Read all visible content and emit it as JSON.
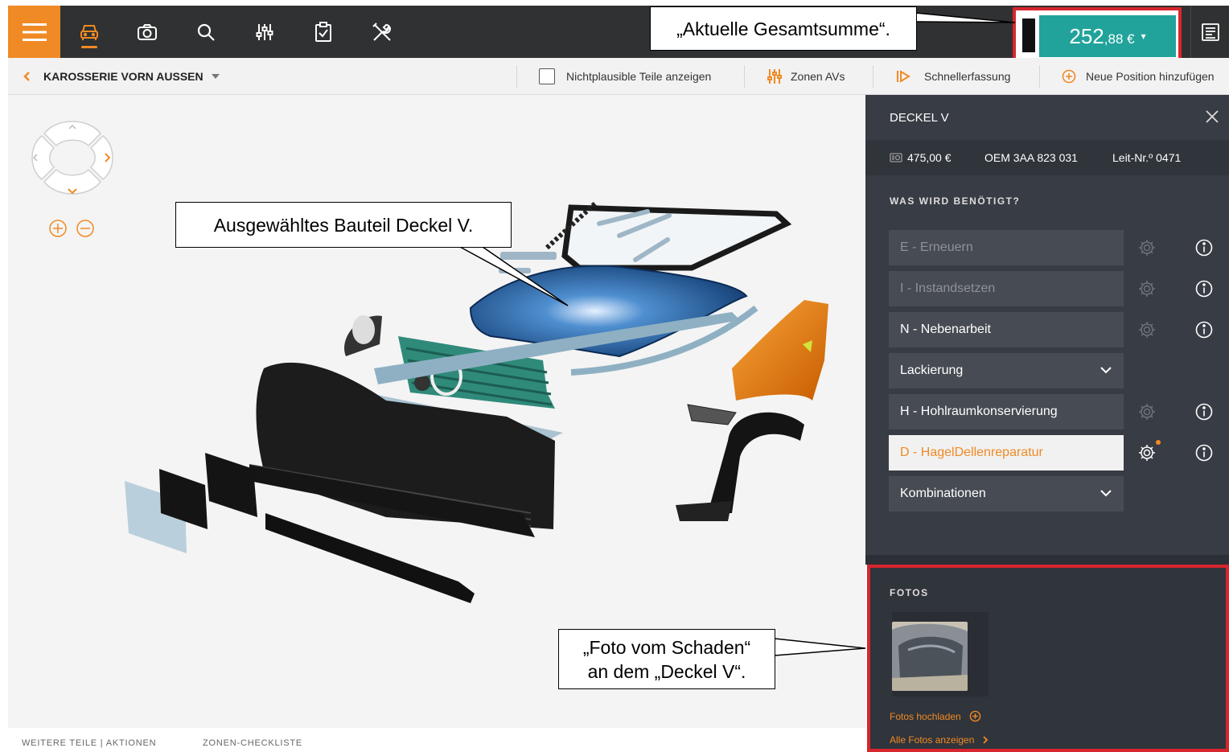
{
  "topbar": {
    "icons": [
      "menu-icon",
      "car-icon",
      "camera-icon",
      "search-icon",
      "sliders-icon",
      "clipboard-check-icon",
      "tools-icon",
      "receipt-icon"
    ],
    "total": {
      "main": "252",
      "cents": ",88 €",
      "caret": "▾"
    },
    "accent": "#f08a24",
    "total_color": "#21a39b",
    "highlight_color": "#d7262e"
  },
  "subbar": {
    "breadcrumb": "KAROSSERIE VORN AUSSEN",
    "implausible_label": "Nichtplausible Teile anzeigen",
    "zones_label": "Zonen AVs",
    "quick_label": "Schnellerfassung",
    "new_position_label": "Neue Position hinzufügen"
  },
  "canvas": {
    "bottom_links": [
      "WEITERE TEILE | AKTIONEN",
      "ZONEN-CHECKLISTE"
    ]
  },
  "panel": {
    "title": "DECKEL V",
    "price": "475,00 €",
    "oem": "OEM 3AA 823 031",
    "leit": "Leit-Nr.º 0471",
    "section_heading": "WAS WIRD BENÖTIGT?",
    "options": [
      {
        "label": "E - Erneuern",
        "state": "dim",
        "gear": true,
        "info": true
      },
      {
        "label": "I - Instandsetzen",
        "state": "dim",
        "gear": true,
        "info": true
      },
      {
        "label": "N - Nebenarbeit",
        "state": "normal",
        "gear": true,
        "info": true
      },
      {
        "label": "Lackierung",
        "state": "normal",
        "dropdown": true
      },
      {
        "label": "H - Hohlraumkonservierung",
        "state": "normal",
        "gear": true,
        "info": true
      },
      {
        "label": "D - HagelDellenreparatur",
        "state": "selected",
        "gear": true,
        "info": true
      },
      {
        "label": "Kombinationen",
        "state": "normal",
        "dropdown": true
      }
    ]
  },
  "photos": {
    "heading": "FOTOS",
    "upload_label": "Fotos hochladen",
    "show_all_label": "Alle Fotos anzeigen"
  },
  "callouts": {
    "total": "„Aktuelle Gesamtsumme“.",
    "part": "Ausgewähltes Bauteil Deckel V.",
    "photo_line1": "„Foto vom Schaden“",
    "photo_line2": "an dem „Deckel V“."
  }
}
